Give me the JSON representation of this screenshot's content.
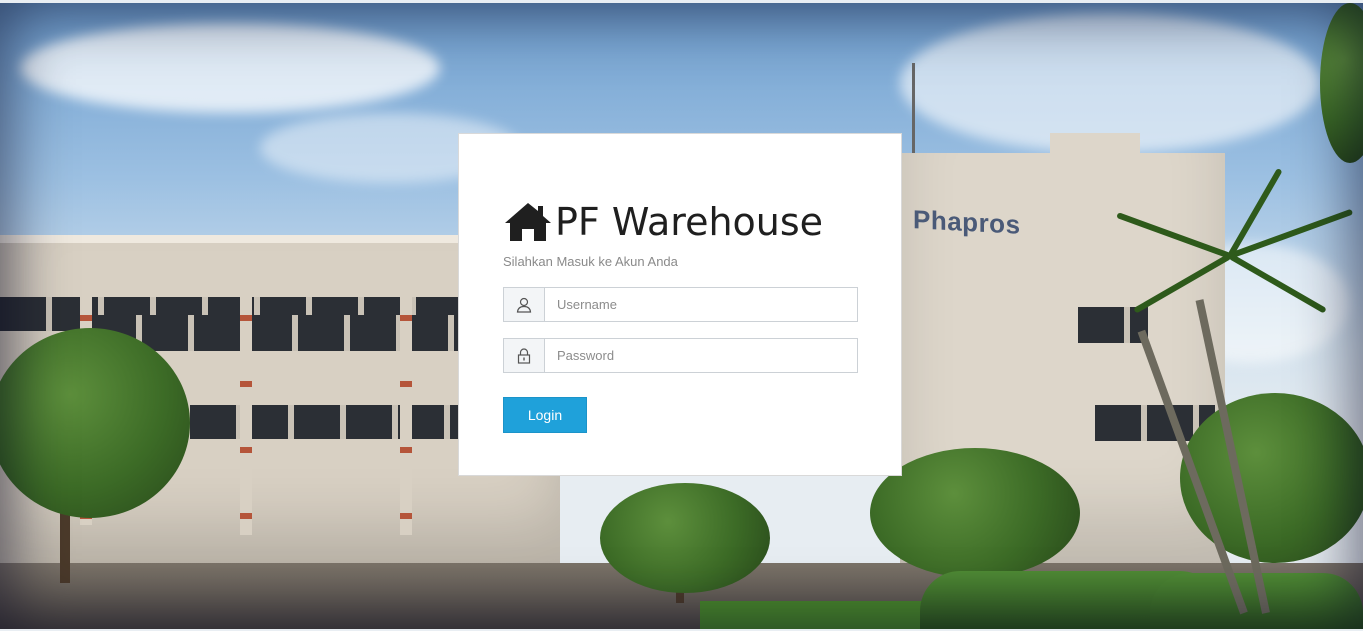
{
  "login": {
    "title": "PF Warehouse",
    "subtitle": "Silahkan Masuk ke Akun Anda",
    "username": {
      "placeholder": "Username",
      "value": "",
      "icon": "user-icon"
    },
    "password": {
      "placeholder": "Password",
      "value": "",
      "icon": "lock-icon"
    },
    "button_label": "Login",
    "title_icon": "home-icon"
  },
  "background": {
    "brand_text": "Phapros"
  },
  "colors": {
    "accent": "#1fa1da",
    "card_bg": "#ffffff",
    "title_text": "#1f1f1f",
    "subtitle_text": "#8a8a8a"
  }
}
